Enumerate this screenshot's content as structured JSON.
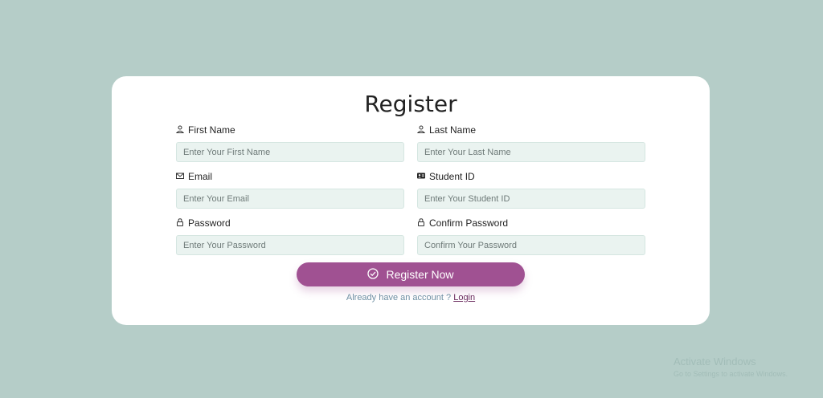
{
  "form": {
    "title": "Register",
    "fields": [
      {
        "label": "First Name",
        "placeholder": "Enter Your First Name",
        "icon": "person-icon"
      },
      {
        "label": "Last Name",
        "placeholder": "Enter Your Last Name",
        "icon": "person-icon"
      },
      {
        "label": "Email",
        "placeholder": "Enter Your Email",
        "icon": "envelope-icon"
      },
      {
        "label": "Student ID",
        "placeholder": "Enter Your Student ID",
        "icon": "id-card-icon"
      },
      {
        "label": "Password",
        "placeholder": "Enter Your Password",
        "icon": "lock-icon"
      },
      {
        "label": "Confirm Password",
        "placeholder": "Confirm Your Password",
        "icon": "lock-icon"
      }
    ],
    "submit_label": "Register Now",
    "submit_icon": "check-circle-icon",
    "login_prompt": "Already have an account ?",
    "login_link": "Login"
  },
  "watermark": {
    "title": "Activate Windows",
    "subtitle": "Go to Settings to activate Windows."
  },
  "colors": {
    "background": "#b5cdc8",
    "card": "#ffffff",
    "input_bg": "#eaf3f0",
    "button": "#a05192",
    "login_prompt": "#6f8fa3"
  }
}
